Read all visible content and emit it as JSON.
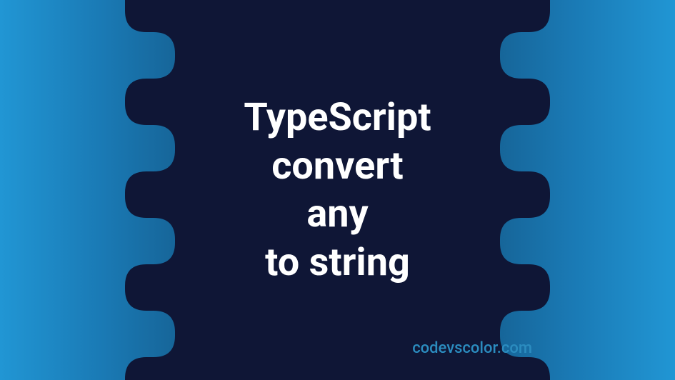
{
  "title": {
    "line1": "TypeScript",
    "line2": "convert",
    "line3": "any",
    "line4": "to string"
  },
  "watermark": "codevscolor.com",
  "colors": {
    "dark_navy": "#0f1636",
    "text_white": "#ffffff",
    "watermark_blue": "#2b8cbf"
  }
}
